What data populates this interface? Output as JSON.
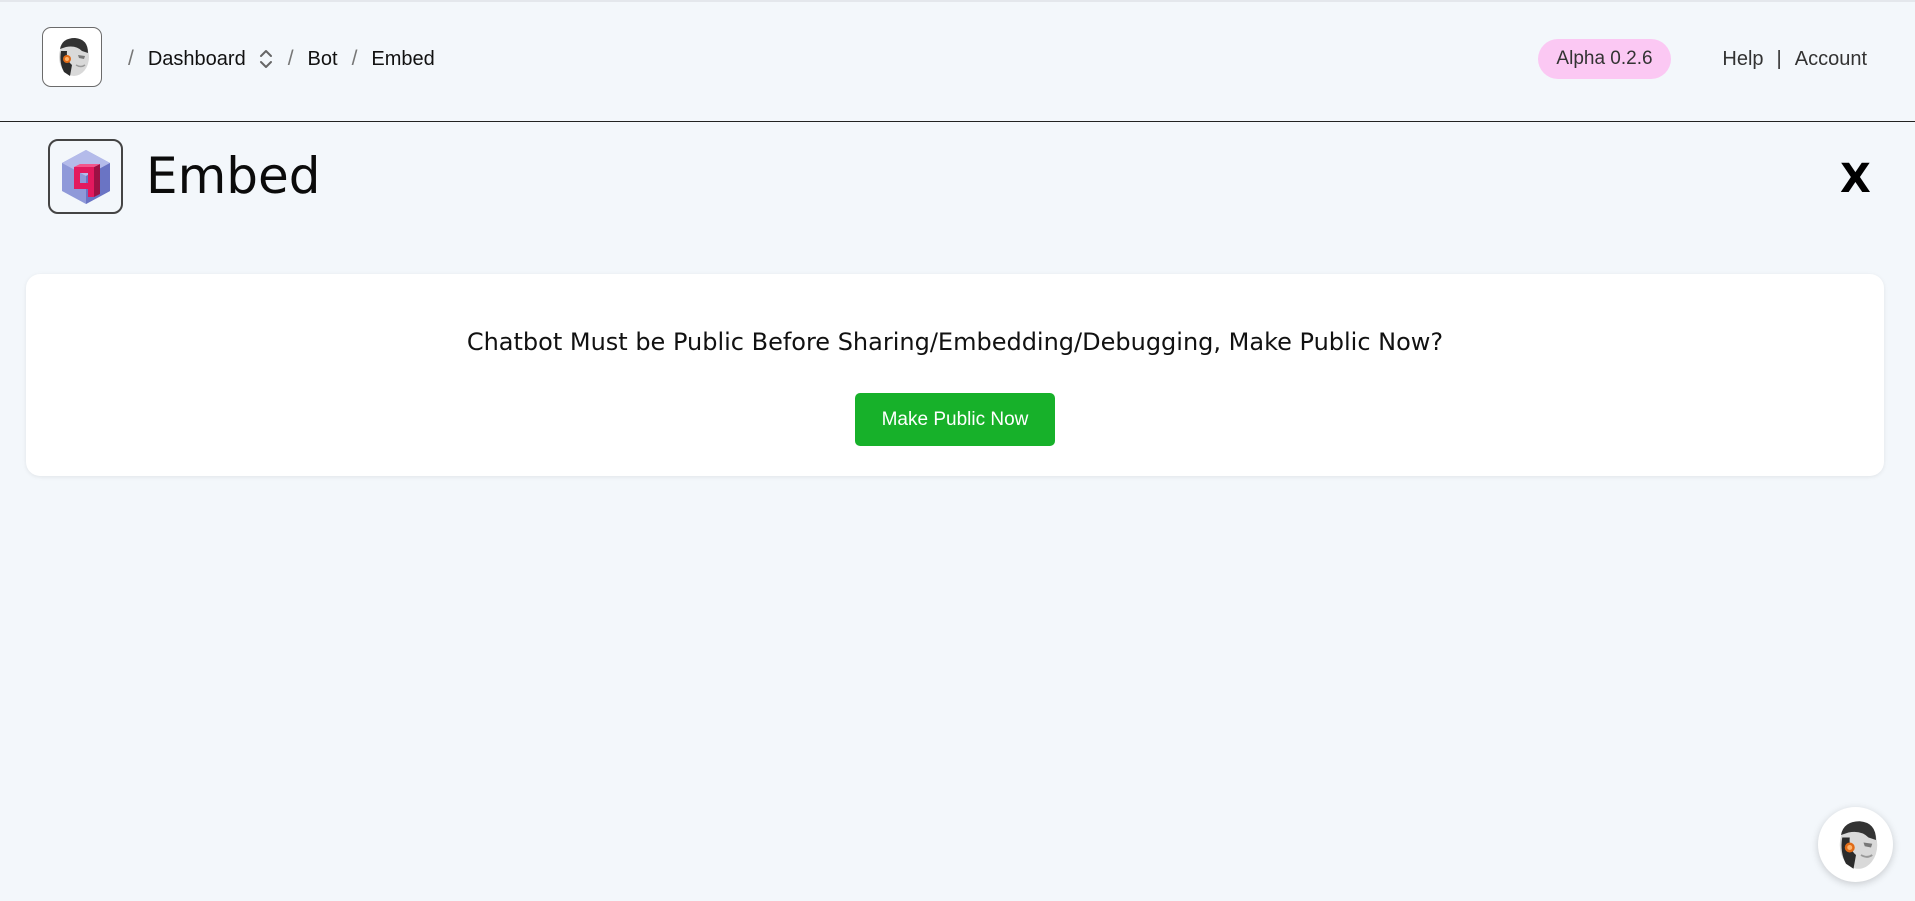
{
  "header": {
    "logo_icon": "robot-head-avatar-icon",
    "breadcrumb": {
      "dashboard": "Dashboard",
      "bot": "Bot",
      "embed": "Embed",
      "separator": "/"
    },
    "version_badge": "Alpha 0.2.6",
    "links": {
      "help": "Help",
      "separator": "|",
      "account": "Account"
    }
  },
  "page": {
    "icon": "cube-q-logo-icon",
    "title": "Embed",
    "close_label": "X"
  },
  "notice_card": {
    "message": "Chatbot Must be Public Before Sharing/Embedding/Debugging, Make Public Now?",
    "button_label": "Make Public Now"
  },
  "chat_widget": {
    "icon": "robot-head-avatar-icon"
  },
  "colors": {
    "background": "#f3f7fb",
    "badge": "#fbc8f3",
    "primary_button": "#17b12a",
    "card": "#ffffff"
  }
}
